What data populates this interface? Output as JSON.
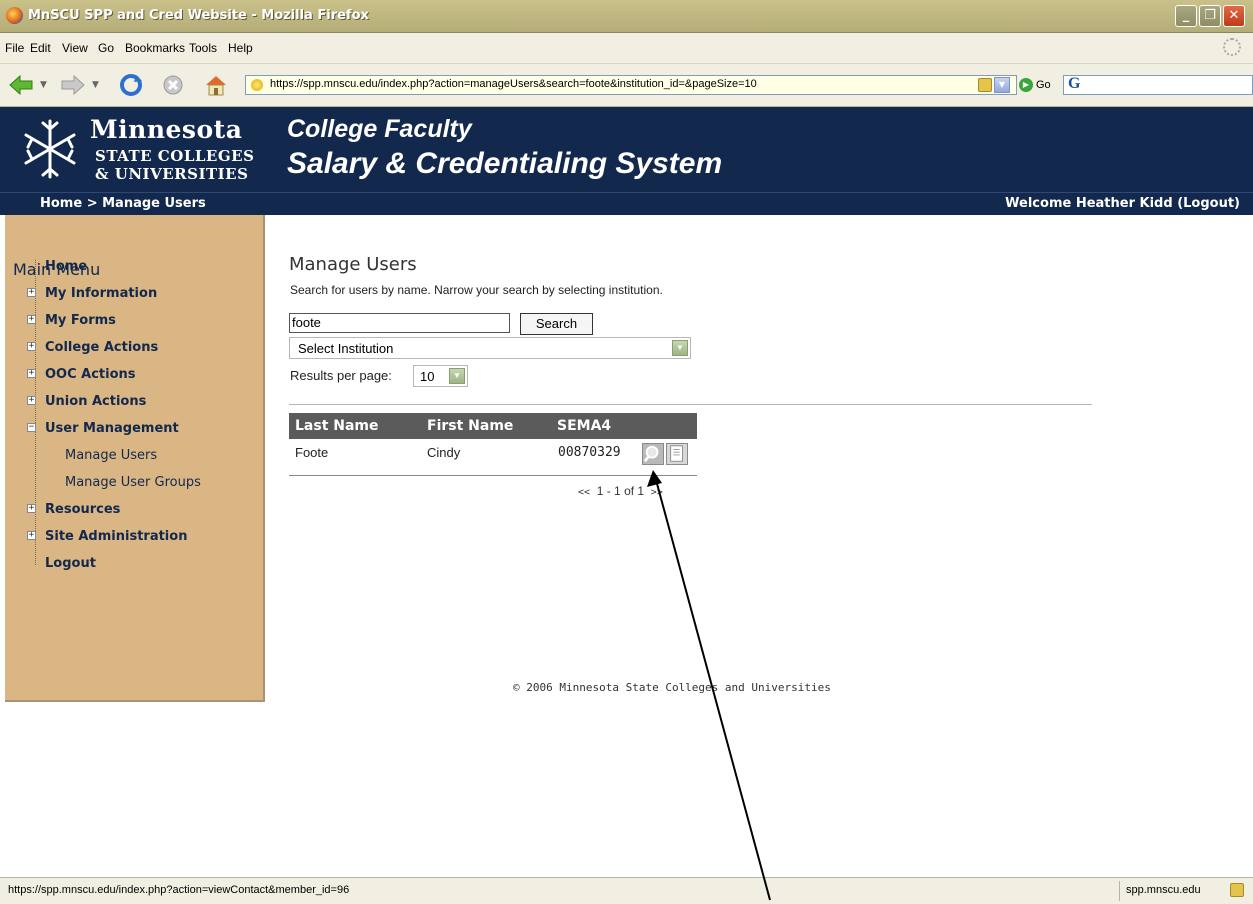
{
  "window": {
    "title": "MnSCU SPP and Cred Website - Mozilla Firefox",
    "controls": {
      "minimize": "_",
      "maximize": "❐",
      "close": "✕"
    }
  },
  "menubar": {
    "items": [
      "File",
      "Edit",
      "View",
      "Go",
      "Bookmarks",
      "Tools",
      "Help"
    ]
  },
  "navbar": {
    "url": "https://spp.mnscu.edu/index.php?action=manageUsers&search=foote&institution_id=&pageSize=10",
    "go_label": "Go",
    "search_engine_glyph": "G"
  },
  "banner": {
    "org_line1": "Minnesota",
    "org_line2": "STATE COLLEGES",
    "org_line3": "& UNIVERSITIES",
    "title_line1": "College Faculty",
    "title_line2": "Salary & Credentialing System"
  },
  "crumbbar": {
    "breadcrumb": "Home > Manage Users",
    "welcome": "Welcome Heather Kidd (Logout)"
  },
  "sidebar": {
    "title": "Main Menu",
    "items": [
      {
        "label": "Home"
      },
      {
        "label": "My Information"
      },
      {
        "label": "My Forms"
      },
      {
        "label": "College Actions"
      },
      {
        "label": "OOC Actions"
      },
      {
        "label": "Union Actions"
      },
      {
        "label": "User Management"
      },
      {
        "label": "Manage Users"
      },
      {
        "label": "Manage User Groups"
      },
      {
        "label": "Resources"
      },
      {
        "label": "Site Administration"
      },
      {
        "label": "Logout"
      }
    ]
  },
  "main": {
    "heading": "Manage Users",
    "description": "Search for users by name. Narrow your search by selecting institution.",
    "search_value": "foote",
    "search_button": "Search",
    "institution_select": "Select Institution",
    "results_per_page_label": "Results per page:",
    "results_per_page_value": "10",
    "table": {
      "headers": [
        "Last Name",
        "First Name",
        "SEMA4"
      ],
      "rows": [
        {
          "last": "Foote",
          "first": "Cindy",
          "sema4": "00870329"
        }
      ]
    },
    "pager": {
      "prev": "<<",
      "range": "1 - 1 of 1",
      "next": ">>"
    },
    "footer": "© 2006 Minnesota State Colleges and Universities"
  },
  "statusbar": {
    "text": "https://spp.mnscu.edu/index.php?action=viewContact&member_id=96",
    "domain": "spp.mnscu.edu"
  },
  "colors": {
    "banner": "#13284d",
    "sidebar": "#d9b684",
    "table_header": "#5b5b5b",
    "chrome": "#f1efe2"
  }
}
